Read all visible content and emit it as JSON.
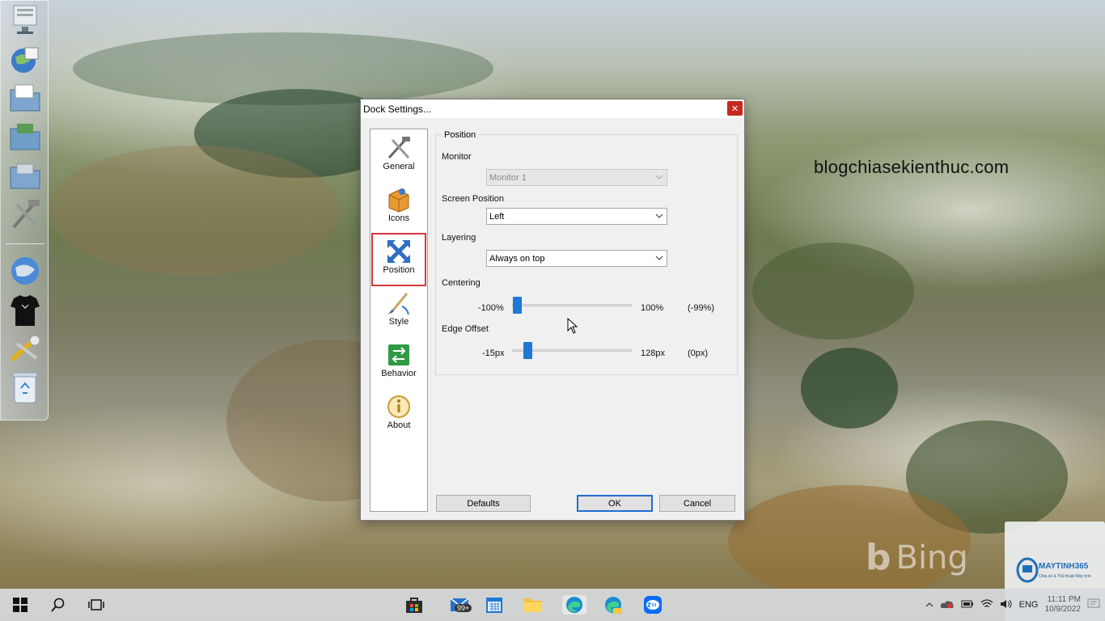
{
  "dialog": {
    "title": "Dock Settings...",
    "nav": [
      {
        "label": "General",
        "icon": "tools-icon"
      },
      {
        "label": "Icons",
        "icon": "box-icon"
      },
      {
        "label": "Position",
        "icon": "arrows-icon",
        "selected": true
      },
      {
        "label": "Style",
        "icon": "brush-icon"
      },
      {
        "label": "Behavior",
        "icon": "behavior-icon"
      },
      {
        "label": "About",
        "icon": "info-icon"
      }
    ],
    "group_title": "Position",
    "monitor": {
      "label": "Monitor",
      "value": "Monitor 1",
      "disabled": true
    },
    "screen_position": {
      "label": "Screen Position",
      "value": "Left"
    },
    "layering": {
      "label": "Layering",
      "value": "Always on top"
    },
    "centering": {
      "label": "Centering",
      "min": "-100%",
      "max": "100%",
      "current": "(-99%)",
      "level": 0.005
    },
    "edge_offset": {
      "label": "Edge Offset",
      "min": "-15px",
      "max": "128px",
      "current": "(0px)",
      "level": 0.105
    },
    "buttons": {
      "defaults": "Defaults",
      "ok": "OK",
      "cancel": "Cancel"
    }
  },
  "desktop": {
    "watermark": "blogchiasekienthuc.com",
    "bing": "Bing"
  },
  "taskbar": {
    "mail_badge": "99+",
    "tray_lang": "ENG",
    "time": "11:11 PM",
    "date": "10/9/2022"
  },
  "logo_card": {
    "brand": "MAYTINH365",
    "tagline": "Chia sẻ & Thủ thuật Máy tính"
  },
  "colors": {
    "accent": "#1e78d6",
    "close": "#c42b1c",
    "highlight": "#d9363e"
  }
}
